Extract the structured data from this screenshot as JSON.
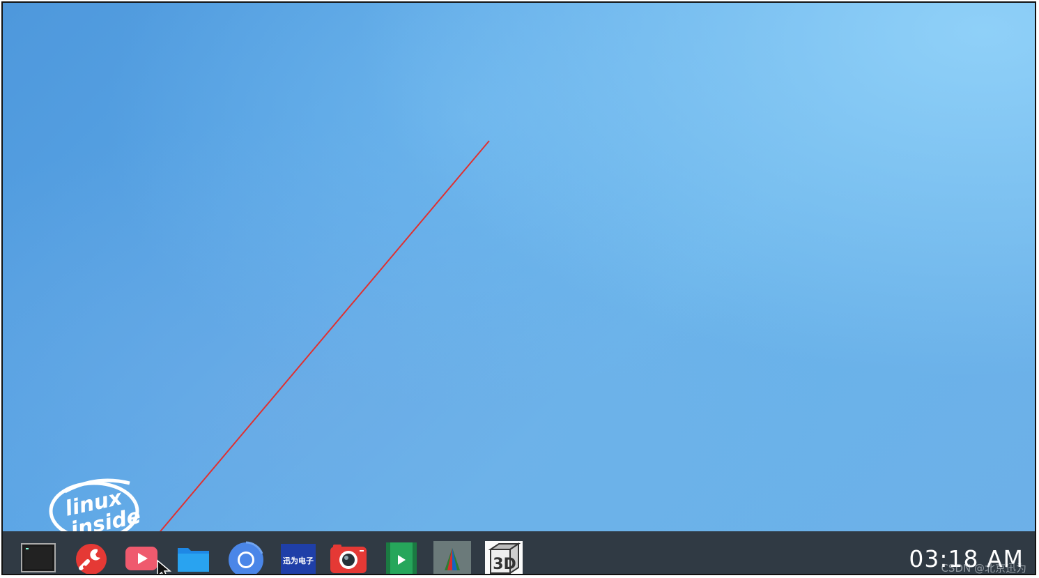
{
  "desktop": {
    "logo": {
      "line1": "linux",
      "line2": "inside",
      "icon": "linux-inside-logo"
    }
  },
  "taskbar": {
    "apps": [
      {
        "icon": "terminal-icon"
      },
      {
        "icon": "settings-wrench-icon"
      },
      {
        "icon": "video-player-icon"
      },
      {
        "icon": "file-manager-folder-icon"
      },
      {
        "icon": "chromium-browser-icon"
      },
      {
        "icon": "vendor-logo-icon",
        "text": "迅为电子"
      },
      {
        "icon": "camera-icon"
      },
      {
        "icon": "media-player-icon"
      },
      {
        "icon": "glmark-triangle-icon"
      },
      {
        "icon": "3d-cube-icon",
        "text": "3D"
      }
    ],
    "clock": "03:18 AM"
  },
  "overlay": {
    "watermark": "CSDN @北京迅为",
    "annotation_line_color": "#e03030"
  },
  "colors": {
    "taskbar_bg": "#303a44",
    "desktop_blue": "#5aa6e6"
  }
}
